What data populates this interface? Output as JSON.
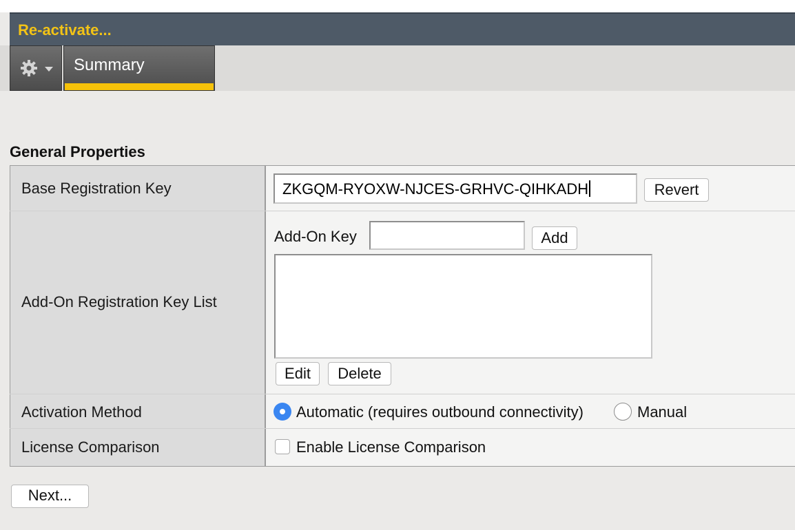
{
  "window": {
    "title": "Re-activate..."
  },
  "tabs": {
    "menu_icon": "gear-icon",
    "summary_label": "Summary"
  },
  "section": {
    "title": "General Properties"
  },
  "base_key": {
    "label": "Base Registration Key",
    "value": "ZKGQM-RYOXW-NJCES-GRHVC-QIHKADH",
    "revert_label": "Revert"
  },
  "addon": {
    "row_label": "Add-On Registration Key List",
    "key_label": "Add-On Key",
    "key_value": "",
    "add_label": "Add",
    "list_items": [],
    "edit_label": "Edit",
    "delete_label": "Delete"
  },
  "activation": {
    "label": "Activation Method",
    "options": [
      "Automatic (requires outbound connectivity)",
      "Manual"
    ],
    "selected": "Automatic (requires outbound connectivity)"
  },
  "license": {
    "label": "License Comparison",
    "checkbox_label": "Enable License Comparison",
    "checked": false
  },
  "footer": {
    "next_label": "Next..."
  },
  "colors": {
    "accent": "#f6c20a",
    "title_bar": "#4e5a67",
    "radio_selected": "#3a86f1"
  }
}
